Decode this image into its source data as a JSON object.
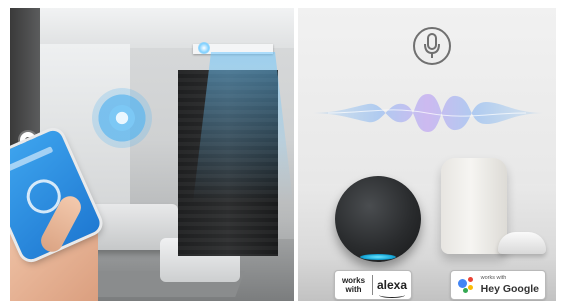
{
  "left_photo": {
    "scene": "smart-home-living-room",
    "icons": [
      "wall-switch-icon",
      "smartphone-icon",
      "wireless-signal-icon"
    ],
    "colors": {
      "signal": "#56b4f0",
      "phone": "#1f79d2"
    }
  },
  "right_panel": {
    "icons": [
      "microphone-icon",
      "voice-wave-icon"
    ],
    "alexa_badge": {
      "works_line1": "works",
      "works_line2": "with",
      "brand": "alexa"
    },
    "google_badge": {
      "small": "works with",
      "brand": "Hey Google"
    },
    "colors": {
      "google_blue": "#4285f4",
      "google_red": "#ea4335",
      "google_yellow": "#fbbc05",
      "google_green": "#34a853",
      "echo_ring": "#14a6d8"
    }
  }
}
